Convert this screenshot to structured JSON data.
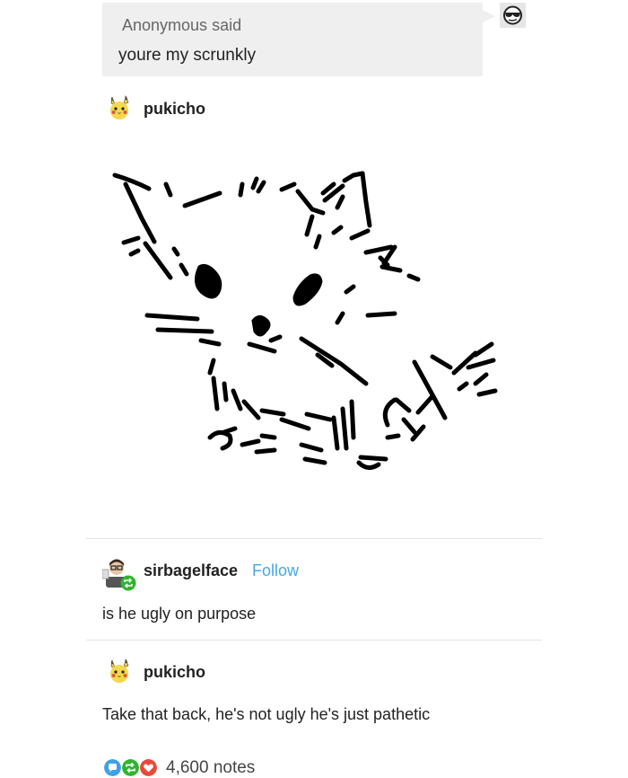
{
  "ask": {
    "author": "Anonymous",
    "said": "said",
    "question": "youre my scrunkly"
  },
  "posts": [
    {
      "username": "pukicho"
    },
    {
      "username": "sirbagelface",
      "follow": "Follow",
      "text": "is he ugly on purpose"
    },
    {
      "username": "pukicho",
      "text": "Take that back, he's not ugly he's just pathetic"
    }
  ],
  "notes": {
    "count": "4,600 notes"
  },
  "icons": {
    "asker_avatar": "sunglasses-face-icon",
    "pukicho_avatar": "pikachu-avatar-icon",
    "sirbagelface_avatar": "glasses-person-avatar-icon",
    "reblog_badge": "reblog-icon",
    "notes": [
      "reply-icon",
      "reblog-icon",
      "like-icon"
    ]
  },
  "colors": {
    "follow_link": "#45a9e4",
    "reply_icon": "#3ea2e5",
    "reblog_icon": "#2eb52e",
    "like_icon": "#e8493a"
  }
}
